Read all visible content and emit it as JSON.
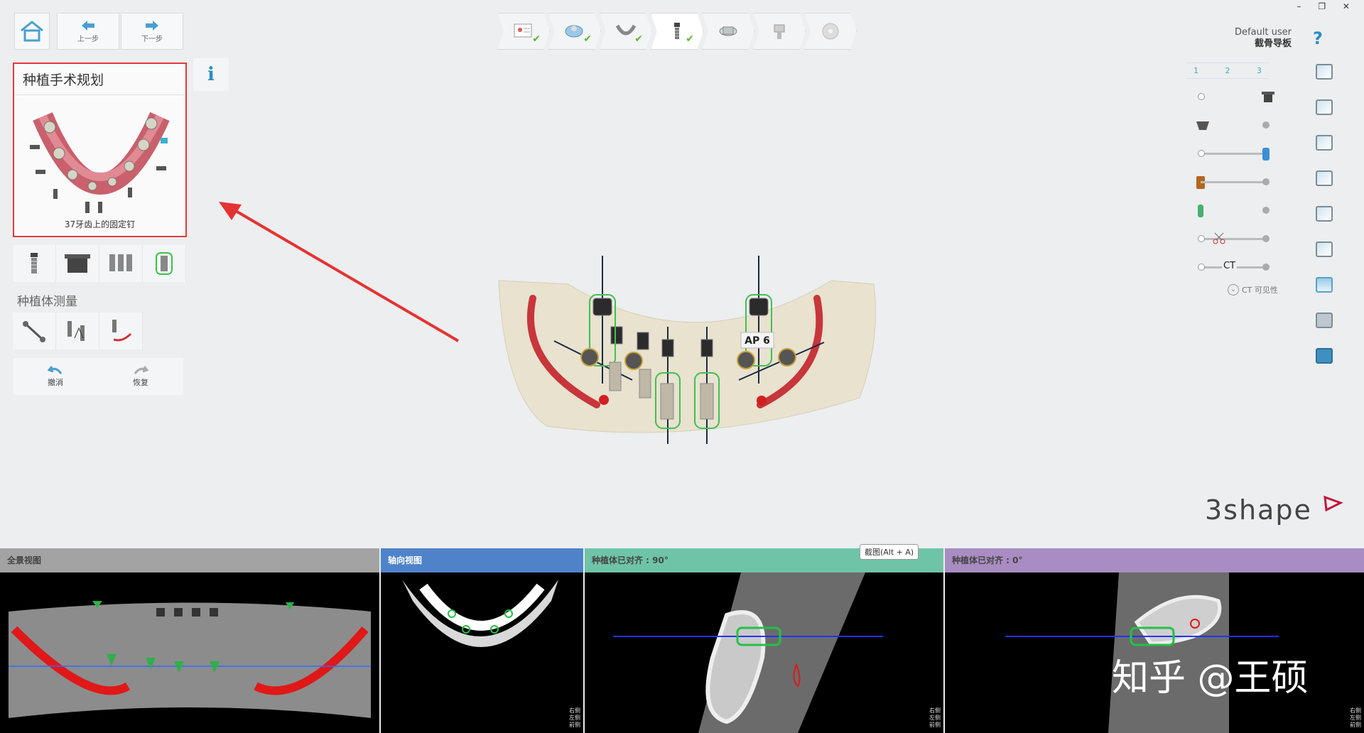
{
  "nav": {
    "prev_label": "上一步",
    "next_label": "下一步"
  },
  "window": {
    "controls": "– ❐ ✕"
  },
  "user": {
    "name": "Default user",
    "project": "截骨导板"
  },
  "help": "?",
  "panel": {
    "title": "种植手术规划",
    "caption": "37牙齿上的固定钉",
    "info": "i"
  },
  "measure_label": "种植体测量",
  "actions": {
    "undo": "撤消",
    "redo": "恢复"
  },
  "layers": {
    "col_numbers": [
      "1",
      "2",
      "3"
    ],
    "ct_label": "CT",
    "ct_visibility": "CT 可见性"
  },
  "scene": {
    "ap_label": "AP 6"
  },
  "brand": "3shape",
  "views": [
    {
      "title": "全景视图",
      "color": "#9b9b9b"
    },
    {
      "title": "轴向视图",
      "color": "#4f83c9"
    },
    {
      "title": "种植体已对齐 : 90°",
      "color": "#6fc4a8"
    },
    {
      "title": "种植体已对齐 : 0°",
      "color": "#a98dc2"
    }
  ],
  "tooltip": "截图(Alt + A)",
  "watermark": "知乎 @王硕",
  "orient_labels": {
    "top": "右侧",
    "mid": "左侧",
    "bot": "前侧"
  }
}
